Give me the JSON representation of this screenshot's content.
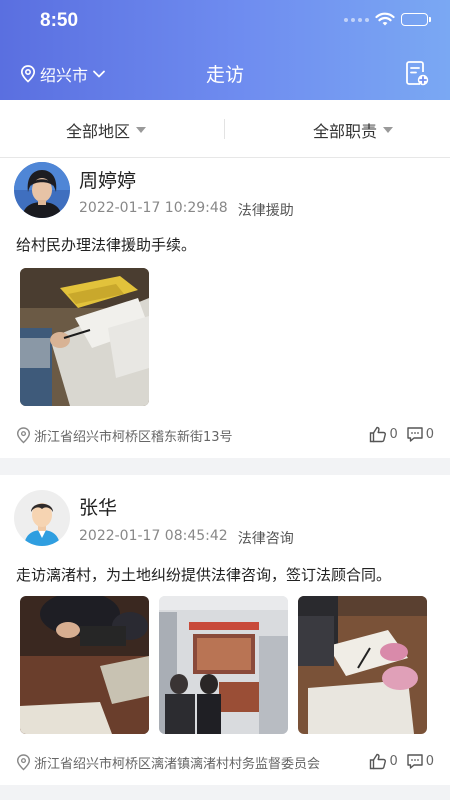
{
  "status_bar": {
    "time": "8:50"
  },
  "header": {
    "city": "绍兴市",
    "title": "走访"
  },
  "filters": {
    "region": "全部地区",
    "duty": "全部职责"
  },
  "posts": [
    {
      "name": "周婷婷",
      "datetime": "2022-01-17 10:29:48",
      "category": "法律援助",
      "content": "给村民办理法律援助手续。",
      "location": "浙江省绍兴市柯桥区稽东新街13号",
      "likes": "0",
      "comments": "0"
    },
    {
      "name": "张华",
      "datetime": "2022-01-17 08:45:42",
      "category": "法律咨询",
      "content": "走访漓渚村，为土地纠纷提供法律咨询，签订法顾合同。",
      "location": "浙江省绍兴市柯桥区漓渚镇漓渚村村务监督委员会",
      "likes": "0",
      "comments": "0"
    }
  ],
  "icons": {
    "location": "location-pin-icon",
    "chevron": "chevron-down-icon",
    "add": "add-document-icon",
    "like": "thumbs-up-icon",
    "comment": "comment-icon"
  },
  "colors": {
    "header_start": "#5a6fe0",
    "header_end": "#7aa8f3"
  }
}
